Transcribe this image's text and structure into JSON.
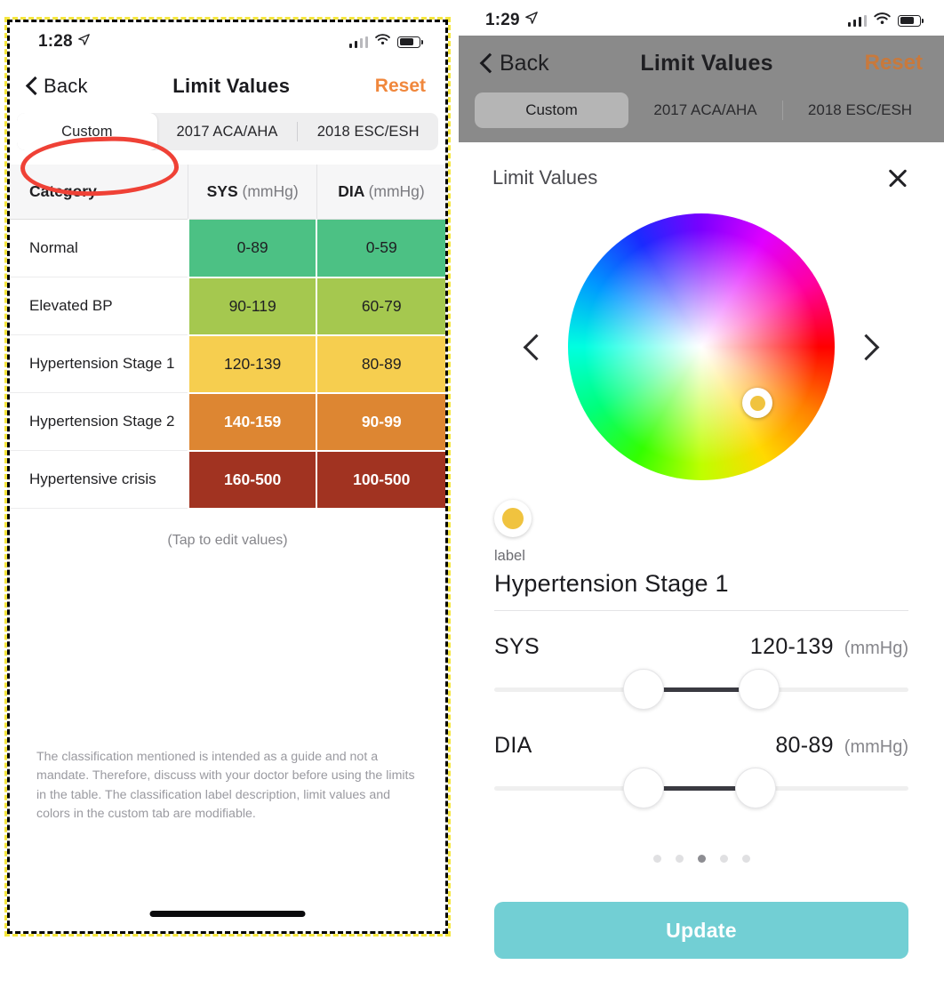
{
  "left_phone": {
    "status_bar": {
      "time": "1:28",
      "location_icon": "location-arrow-icon",
      "signal_icon": "cellular-bars-icon",
      "wifi_icon": "wifi-icon",
      "battery_icon": "battery-icon"
    },
    "nav": {
      "back_label": "Back",
      "title": "Limit Values",
      "reset_label": "Reset",
      "back_icon": "chevron-left-icon"
    },
    "segments": [
      {
        "label": "Custom",
        "active": true
      },
      {
        "label": "2017 ACA/AHA",
        "active": false
      },
      {
        "label": "2018 ESC/ESH",
        "active": false
      }
    ],
    "annotation": {
      "shape": "red-ellipse",
      "color": "#ef4136",
      "targets": "Custom"
    },
    "table": {
      "headers": {
        "category": "Category",
        "sys": "SYS",
        "sys_unit": "(mmHg)",
        "dia": "DIA",
        "dia_unit": "(mmHg)"
      },
      "rows": [
        {
          "category": "Normal",
          "sys": "0-89",
          "dia": "0-59",
          "color": "#4cc184",
          "text_light": false
        },
        {
          "category": "Elevated BP",
          "sys": "90-119",
          "dia": "60-79",
          "color": "#a5c84f",
          "text_light": false
        },
        {
          "category": "Hypertension Stage 1",
          "sys": "120-139",
          "dia": "80-89",
          "color": "#f6ce4f",
          "text_light": false
        },
        {
          "category": "Hypertension Stage 2",
          "sys": "140-159",
          "dia": "90-99",
          "color": "#dd8632",
          "text_light": true
        },
        {
          "category": "Hypertensive crisis",
          "sys": "160-500",
          "dia": "100-500",
          "color": "#a13321",
          "text_light": true
        }
      ]
    },
    "tap_hint": "(Tap to edit values)",
    "disclaimer": "The classification mentioned is intended as a guide and not a mandate. Therefore, discuss with your doctor before using the limits in the table. The classification label description, limit values and colors in the custom tab are modifiable."
  },
  "right_phone": {
    "status_bar": {
      "time": "1:29",
      "location_icon": "location-arrow-icon",
      "signal_icon": "cellular-bars-icon",
      "wifi_icon": "wifi-icon",
      "battery_icon": "battery-icon"
    },
    "nav": {
      "back_label": "Back",
      "title": "Limit Values",
      "reset_label": "Reset",
      "back_icon": "chevron-left-icon"
    },
    "segments": [
      {
        "label": "Custom",
        "active": true
      },
      {
        "label": "2017 ACA/AHA",
        "active": false
      },
      {
        "label": "2018 ESC/ESH",
        "active": false
      }
    ],
    "sheet": {
      "title": "Limit Values",
      "close_icon": "close-icon",
      "color_picker": {
        "prev_icon": "chevron-left-icon",
        "next_icon": "chevron-right-icon",
        "selected_color": "#f0c33f",
        "knob_icon": "color-knob-icon"
      },
      "label_caption": "label",
      "label_value": "Hypertension  Stage 1",
      "sliders": [
        {
          "name": "SYS",
          "value": "120-139",
          "unit": "(mmHg)",
          "low_pct": 36,
          "high_pct": 64
        },
        {
          "name": "DIA",
          "value": "80-89",
          "unit": "(mmHg)",
          "low_pct": 36,
          "high_pct": 63
        }
      ],
      "page_dots": {
        "count": 5,
        "active_index": 2
      },
      "update_label": "Update",
      "update_color": "#72cfd4"
    }
  }
}
